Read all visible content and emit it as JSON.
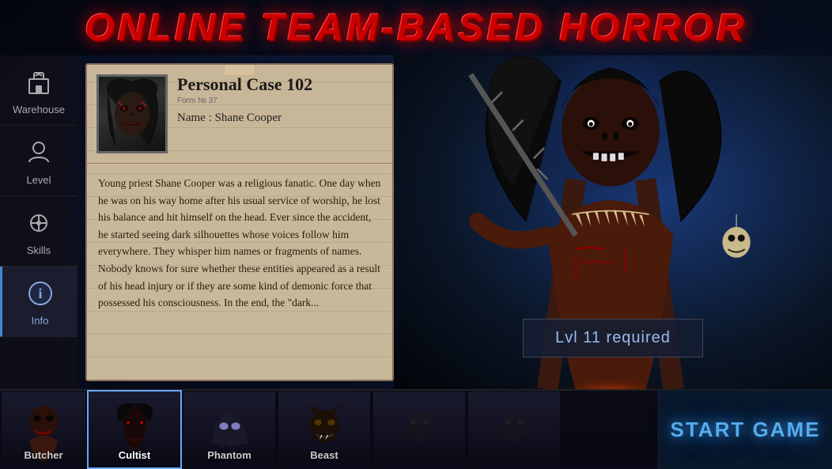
{
  "header": {
    "title": "ONLINE TEAM-BASED HORROR"
  },
  "sidebar": {
    "items": [
      {
        "id": "warehouse",
        "label": "Warehouse",
        "icon": "backpack"
      },
      {
        "id": "level",
        "label": "Level",
        "icon": "person"
      },
      {
        "id": "skills",
        "label": "Skills",
        "icon": "gear-plus"
      },
      {
        "id": "info",
        "label": "Info",
        "icon": "info",
        "active": true
      }
    ]
  },
  "case": {
    "title": "Personal Case 102",
    "form_label": "Form № 37",
    "name_label": "Name : Shane Cooper",
    "description": "Young priest Shane Cooper was a religious fanatic. One day when he was on his way home after his usual service of worship, he lost his balance and hit himself on the head. Ever since the accident, he started seeing dark silhouettes whose voices follow him everywhere. They whisper him names or fragments of names. Nobody knows for sure whether these entities appeared as a result of his head injury or if they are some kind of demonic force that possessed his consciousness. In the end, the \"dark..."
  },
  "monster": {
    "level_required": "Lvl 11 required"
  },
  "characters": [
    {
      "id": "butcher",
      "label": "Butcher",
      "active": false
    },
    {
      "id": "cultist",
      "label": "Cultist",
      "active": true
    },
    {
      "id": "phantom",
      "label": "Phantom",
      "active": false
    },
    {
      "id": "beast",
      "label": "Beast",
      "active": false
    },
    {
      "id": "slot5",
      "label": "",
      "active": false
    },
    {
      "id": "slot6",
      "label": "",
      "active": false
    }
  ],
  "start_button": {
    "label": "START GAME"
  },
  "colors": {
    "accent_red": "#cc0000",
    "accent_blue": "#55aaee",
    "active_border": "#66aaff"
  }
}
